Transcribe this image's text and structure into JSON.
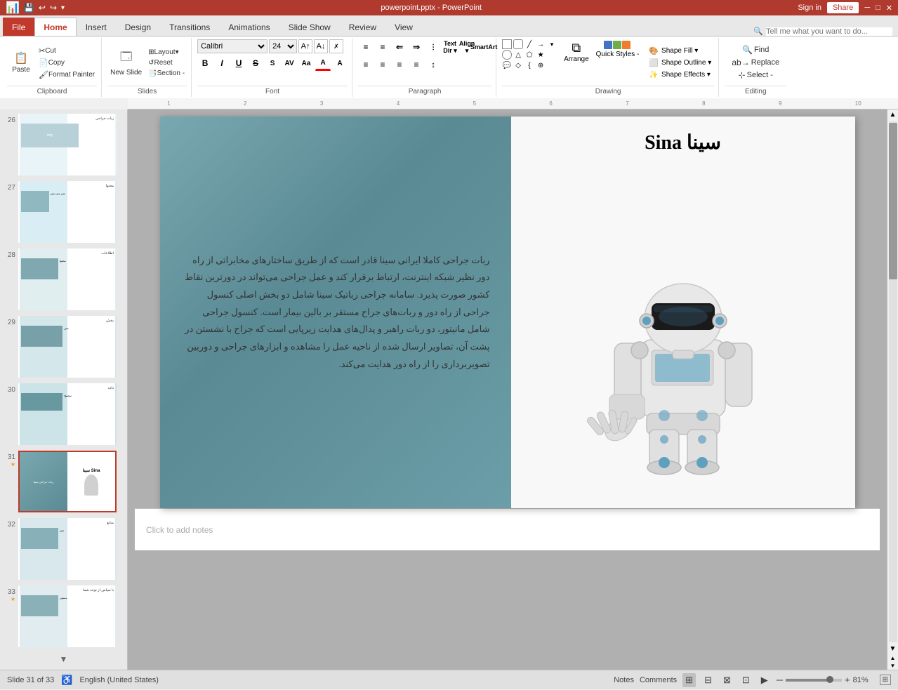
{
  "titlebar": {
    "title": "powerpoint.pptx - PowerPoint",
    "sign_in": "Sign in",
    "share": "Share"
  },
  "quickaccess": {
    "save": "💾",
    "undo": "↩",
    "redo": "↪",
    "customize": "▾"
  },
  "tabs": [
    {
      "id": "file",
      "label": "File"
    },
    {
      "id": "home",
      "label": "Home",
      "active": true
    },
    {
      "id": "insert",
      "label": "Insert"
    },
    {
      "id": "design",
      "label": "Design"
    },
    {
      "id": "transitions",
      "label": "Transitions"
    },
    {
      "id": "animations",
      "label": "Animations"
    },
    {
      "id": "slideshow",
      "label": "Slide Show"
    },
    {
      "id": "review",
      "label": "Review"
    },
    {
      "id": "view",
      "label": "View"
    }
  ],
  "ribbon": {
    "tell_me": "Tell me what you want to do...",
    "groups": {
      "clipboard": {
        "label": "Clipboard",
        "paste": "Paste",
        "cut": "Cut",
        "copy": "Copy",
        "format_painter": "Format Painter"
      },
      "slides": {
        "label": "Slides",
        "new_slide": "New Slide",
        "layout": "Layout",
        "reset": "Reset",
        "section": "Section -"
      },
      "font": {
        "label": "Font",
        "font_name": "",
        "font_size": "24",
        "bold": "B",
        "italic": "I",
        "underline": "U",
        "strikethrough": "S",
        "shadow": "S",
        "increase": "A↑",
        "decrease": "A↓",
        "clear": "A",
        "color": "A",
        "highlight": "A"
      },
      "paragraph": {
        "label": "Paragraph",
        "bullets": "≡",
        "numbered": "≡",
        "decrease_indent": "⇐",
        "increase_indent": "⇒",
        "text_direction": "Text Direction",
        "align_text": "Align Text",
        "convert": "Convert to SmartArt",
        "align_left": "≡",
        "center": "≡",
        "align_right": "≡",
        "justify": "≡",
        "columns": "⋮",
        "line_spacing": "↕"
      },
      "drawing": {
        "label": "Drawing",
        "shape_fill": "Shape Fill ▾",
        "shape_outline": "Shape Outline",
        "shape_effects": "Shape Effects",
        "shape_label": "Shape",
        "arrange": "Arrange",
        "quick_styles": "Quick Styles -"
      },
      "editing": {
        "label": "Editing",
        "find": "Find",
        "replace": "Replace",
        "select": "Select -"
      }
    }
  },
  "slides": [
    {
      "num": "26",
      "starred": false
    },
    {
      "num": "27",
      "starred": false
    },
    {
      "num": "28",
      "starred": false
    },
    {
      "num": "29",
      "starred": false
    },
    {
      "num": "30",
      "starred": false
    },
    {
      "num": "31",
      "starred": true,
      "active": true
    },
    {
      "num": "32",
      "starred": false
    },
    {
      "num": "33",
      "starred": true
    }
  ],
  "slide": {
    "title_rtl": "سینا Sina",
    "body_text": "ربات جراحی کاملا ایرانی سینا قادر است که از طریق ساختارهای مخابراتی از راه دور نظیر شبکه اینترنت، ارتباط برقرار کند و عمل جراحی می‌تواند در دورترین نقاط کشور صورت پذیرد. سامانه جراحی رباتیک سینا شامل دو بخش اصلی کنسول جراحی از راه دور و ربات‌های جراح مستقر بر بالین بیمار است. کنسول جراحی شامل مانیتور، دو ربات راهبر و پدال‌های هدایت زیرپایی است که جراح با نشستن در پشت آن، تصاویر ارسال شده از ناحیه عمل را مشاهده و ابزارهای جراحی و دوربین تصویربرداری را از راه دور هدایت می‌کند.",
    "notes_placeholder": "Click to add notes"
  },
  "statusbar": {
    "slide_info": "Slide 31 of 33",
    "language": "English (United States)",
    "notes": "Notes",
    "comments": "Comments",
    "zoom": "81%",
    "zoom_level": 81
  }
}
